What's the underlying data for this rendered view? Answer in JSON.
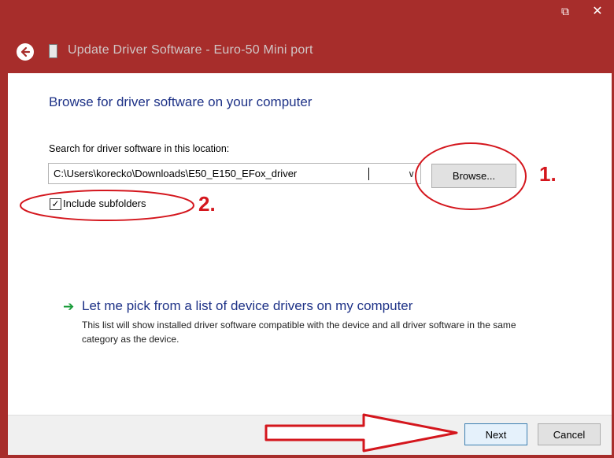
{
  "window": {
    "title": "Update Driver Software - Euro-50 Mini port",
    "close_glyph": "✕",
    "restore_glyph": "⧉"
  },
  "content": {
    "heading": "Browse for driver software on your computer",
    "search_label": "Search for driver software in this location:",
    "path_value": "C:\\Users\\korecko\\Downloads\\E50_E150_EFox_driver",
    "browse_label": "Browse...",
    "include_subfolders_label": "Include subfolders",
    "include_subfolders_checked": true,
    "pick_title": "Let me pick from a list of device drivers on my computer",
    "pick_description": "This list will show installed driver software compatible with the device and all driver software in the same category as the device."
  },
  "footer": {
    "next_label": "Next",
    "cancel_label": "Cancel"
  },
  "annotations": {
    "step1": "1.",
    "step2": "2.",
    "color": "#d4161d"
  },
  "colors": {
    "title_bar": "#a72d2b",
    "heading_blue": "#1e3287",
    "arrow_green": "#1a9c3a"
  },
  "icons": [
    "back-arrow-icon",
    "app-icon",
    "restore-icon",
    "close-icon",
    "dropdown-chevron-icon",
    "checkmark-icon",
    "green-arrow-icon"
  ]
}
